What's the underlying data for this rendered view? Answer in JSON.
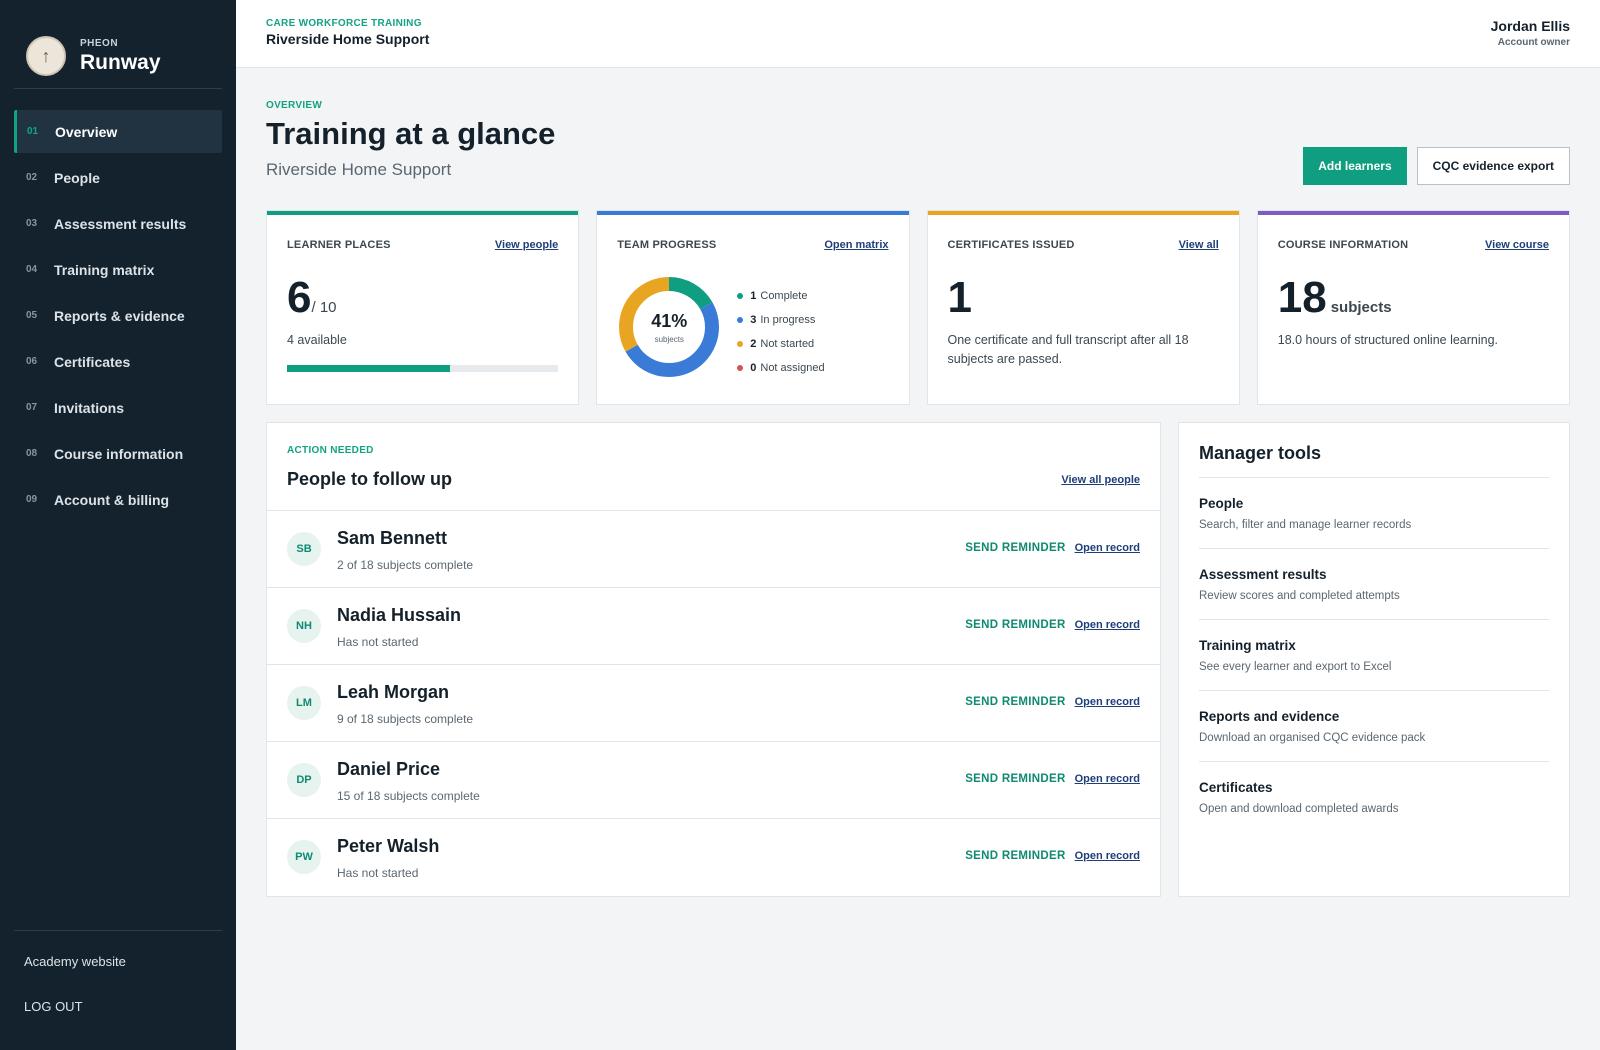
{
  "brand": {
    "sub": "PHEON",
    "name": "Runway",
    "logo_icon": "pheon-arrow-icon"
  },
  "nav": [
    {
      "num": "01",
      "label": "Overview",
      "active": true
    },
    {
      "num": "02",
      "label": "People"
    },
    {
      "num": "03",
      "label": "Assessment results"
    },
    {
      "num": "04",
      "label": "Training matrix"
    },
    {
      "num": "05",
      "label": "Reports & evidence"
    },
    {
      "num": "06",
      "label": "Certificates"
    },
    {
      "num": "07",
      "label": "Invitations"
    },
    {
      "num": "08",
      "label": "Course information"
    },
    {
      "num": "09",
      "label": "Account & billing"
    }
  ],
  "sidebar_footer": {
    "website": "Academy website",
    "logout": "LOG OUT"
  },
  "topbar": {
    "kicker": "CARE WORKFORCE TRAINING",
    "org": "Riverside Home Support",
    "user_name": "Jordan Ellis",
    "user_role": "Account owner"
  },
  "page": {
    "kicker": "OVERVIEW",
    "title": "Training at a glance",
    "subtitle": "Riverside Home Support",
    "add_learners": "Add learners",
    "export": "CQC evidence export"
  },
  "cards": {
    "learner_places": {
      "title": "LEARNER PLACES",
      "link": "View people",
      "used": "6",
      "of": "/ 10",
      "note": "4 available",
      "fill": 0.6,
      "color": "#0f9e80"
    },
    "team_progress": {
      "title": "TEAM PROGRESS",
      "link": "Open matrix",
      "pct": "41%",
      "pct_sub": "subjects",
      "color": "#3b7bd8",
      "legend": [
        {
          "count": "1",
          "label": "Complete",
          "color": "#0f9e80"
        },
        {
          "count": "3",
          "label": "In progress",
          "color": "#3b7bd8"
        },
        {
          "count": "2",
          "label": "Not started",
          "color": "#e8a521"
        },
        {
          "count": "0",
          "label": "Not assigned",
          "color": "#d9534f"
        }
      ]
    },
    "certificates": {
      "title": "CERTIFICATES ISSUED",
      "link": "View all",
      "value": "1",
      "note": "One certificate and full transcript after all 18 subjects are passed.",
      "color": "#e8a521"
    },
    "course": {
      "title": "COURSE INFORMATION",
      "link": "View course",
      "value": "18",
      "unit": "subjects",
      "note": "18.0 hours of structured online learning.",
      "color": "#7c5cc4"
    }
  },
  "follow_up": {
    "kicker": "ACTION NEEDED",
    "title": "People to follow up",
    "link": "View all people",
    "send_label": "SEND REMINDER",
    "open_label": "Open record",
    "people": [
      {
        "initials": "SB",
        "name": "Sam Bennett",
        "status": "2 of 18 subjects complete"
      },
      {
        "initials": "NH",
        "name": "Nadia Hussain",
        "status": "Has not started"
      },
      {
        "initials": "LM",
        "name": "Leah Morgan",
        "status": "9 of 18 subjects complete"
      },
      {
        "initials": "DP",
        "name": "Daniel Price",
        "status": "15 of 18 subjects complete"
      },
      {
        "initials": "PW",
        "name": "Peter Walsh",
        "status": "Has not started"
      }
    ]
  },
  "manager_tools": {
    "title": "Manager tools",
    "items": [
      {
        "name": "People",
        "desc": "Search, filter and manage learner records"
      },
      {
        "name": "Assessment results",
        "desc": "Review scores and completed attempts"
      },
      {
        "name": "Training matrix",
        "desc": "See every learner and export to Excel"
      },
      {
        "name": "Reports and evidence",
        "desc": "Download an organised CQC evidence pack"
      },
      {
        "name": "Certificates",
        "desc": "Open and download completed awards"
      }
    ]
  }
}
